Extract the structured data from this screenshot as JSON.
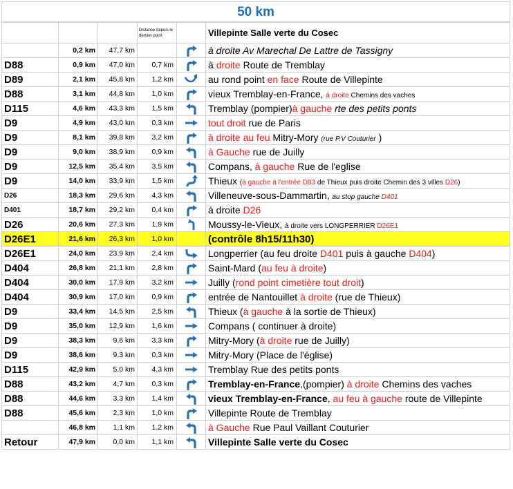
{
  "title": "50 km",
  "header": {
    "segment_label": "Distance depuis le dernier point",
    "start_label": "Villepinte Salle verte du Cosec"
  },
  "rows": [
    {
      "road": "",
      "cum": "0,2 km",
      "rem": "47,7 km",
      "seg": "",
      "arrow": "turn-right",
      "parts": [
        {
          "t": "à droite Av Marechal De Lattre de Tassigny",
          "s": "it"
        }
      ]
    },
    {
      "road": "D88",
      "cum": "0,9 km",
      "rem": "47,0 km",
      "seg": "0,7 km",
      "arrow": "turn-right",
      "parts": [
        {
          "t": "à "
        },
        {
          "t": "droite",
          "s": "red"
        },
        {
          "t": " Route de Tremblay"
        }
      ]
    },
    {
      "road": "D89",
      "cum": "2,1 km",
      "rem": "45,8 km",
      "seg": "1,2 km",
      "arrow": "roundabout-straight",
      "parts": [
        {
          "t": "au rond point "
        },
        {
          "t": "en face",
          "s": "red"
        },
        {
          "t": " Route de Villepinte"
        }
      ]
    },
    {
      "road": "D88",
      "cum": "3,1 km",
      "rem": "44,8 km",
      "seg": "1,0 km",
      "arrow": "turn-right",
      "parts": [
        {
          "t": "vieux Tremblay-en-France, "
        },
        {
          "t": "à droite",
          "s": "red tiny"
        },
        {
          "t": " Chemins des vaches",
          "s": "tiny"
        }
      ]
    },
    {
      "road": "D115",
      "cum": "4,6 km",
      "rem": "43,3 km",
      "seg": "1,5 km",
      "arrow": "turn-left",
      "parts": [
        {
          "t": "Tremblay (pompier)"
        },
        {
          "t": "à gauche",
          "s": "red"
        },
        {
          "t": " rte des petits ponts",
          "s": "it"
        }
      ]
    },
    {
      "road": "D9",
      "cum": "4,9 km",
      "rem": "43,0 km",
      "seg": "0,3 km",
      "arrow": "straight",
      "parts": [
        {
          "t": "tout droit",
          "s": "red"
        },
        {
          "t": " rue de Paris"
        }
      ]
    },
    {
      "road": "D9",
      "cum": "8,1 km",
      "rem": "39,8 km",
      "seg": "3,2 km",
      "arrow": "turn-right",
      "parts": [
        {
          "t": "à droite au feu",
          "s": "red"
        },
        {
          "t": " Mitry-Mory "
        },
        {
          "t": "(rue P.V Couturier",
          "s": "it tiny"
        },
        {
          "t": " )"
        }
      ]
    },
    {
      "road": "D9",
      "cum": "9,0 km",
      "rem": "38,9 km",
      "seg": "0,9 km",
      "arrow": "turn-left",
      "parts": [
        {
          "t": "à Gauche",
          "s": "red"
        },
        {
          "t": "   rue de Juilly"
        }
      ]
    },
    {
      "road": "D9",
      "cum": "12,5 km",
      "rem": "35,4 km",
      "seg": "3,5 km",
      "arrow": "turn-left",
      "parts": [
        {
          "t": "Compans, "
        },
        {
          "t": "à gauche",
          "s": "red"
        },
        {
          "t": " Rue de l'eglise",
          "s": "sm"
        }
      ]
    },
    {
      "road": "D9",
      "cum": "14,0 km",
      "rem": "33,9 km",
      "seg": "1,5 km",
      "arrow": "left-then-right",
      "parts": [
        {
          "t": "Thieux "
        },
        {
          "t": "(",
          "s": "tiny"
        },
        {
          "t": "à gauche à l'entrée D83",
          "s": "red tiny"
        },
        {
          "t": "  de Thieux puis droite Chemin des 3 villes ",
          "s": "tiny"
        },
        {
          "t": "D26",
          "s": "red tiny"
        },
        {
          "t": ")",
          "s": "tiny"
        }
      ]
    },
    {
      "road": "D26",
      "small": true,
      "cum": "18,3 km",
      "rem": "29,6 km",
      "seg": "4,3 km",
      "arrow": "turn-left",
      "parts": [
        {
          "t": "Villeneuve-sous-Dammartin, "
        },
        {
          "t": "au stop gauche ",
          "s": "it tiny"
        },
        {
          "t": "D401",
          "s": "red it tiny"
        }
      ]
    },
    {
      "road": "D401",
      "small": true,
      "cum": "18,7 km",
      "rem": "29,2 km",
      "seg": "0,4 km",
      "arrow": "turn-right",
      "parts": [
        {
          "t": " à droite "
        },
        {
          "t": "D26",
          "s": "red"
        }
      ]
    },
    {
      "road": "D26",
      "cum": "20,6 km",
      "rem": "27,3 km",
      "seg": "1,9 km",
      "arrow": "slight-left",
      "parts": [
        {
          "t": "Moussy-le-Vieux, "
        },
        {
          "t": " à droite vers LONGPERRIER ",
          "s": "tiny"
        },
        {
          "t": "D26E1",
          "s": "red tiny"
        }
      ]
    },
    {
      "road": "D26E1",
      "control": true,
      "cum": "21,6 km",
      "rem": "26,3 km",
      "seg": "1,0 km",
      "arrow": "",
      "parts": [
        {
          "t": "(contrôle 8h15/11h30)"
        }
      ]
    },
    {
      "road": "D26E1",
      "cum": "24,0 km",
      "rem": "23,9 km",
      "seg": "2,4 km",
      "arrow": "right-then-left",
      "parts": [
        {
          "t": "Longperrier "
        },
        {
          "t": "(au feu droite  ",
          "s": "sm"
        },
        {
          "t": "D401",
          "s": "red sm"
        },
        {
          "t": "  puis à gauche ",
          "s": "sm"
        },
        {
          "t": "D404",
          "s": "red sm"
        },
        {
          "t": ")",
          "s": "sm"
        }
      ]
    },
    {
      "road": "D404",
      "cum": "26,8 km",
      "rem": "21,1 km",
      "seg": "2,8 km",
      "arrow": "turn-right",
      "parts": [
        {
          "t": "Saint-Mard ("
        },
        {
          "t": "au feu à droite",
          "s": "red"
        },
        {
          "t": ")"
        }
      ]
    },
    {
      "road": "D404",
      "cum": "30,0 km",
      "rem": "17,9 km",
      "seg": "3,2 km",
      "arrow": "straight",
      "parts": [
        {
          "t": "Juilly ("
        },
        {
          "t": "rond point cimetière tout droit",
          "s": "red"
        },
        {
          "t": ")"
        }
      ]
    },
    {
      "road": "D404",
      "cum": "30,9 km",
      "rem": "17,0 km",
      "seg": "0,9 km",
      "arrow": "turn-right",
      "parts": [
        {
          "t": "entrée de Nantouillet "
        },
        {
          "t": "à droite",
          "s": "red"
        },
        {
          "t": " (rue de Thieux)"
        }
      ]
    },
    {
      "road": "D9",
      "cum": "33,4 km",
      "rem": "14,5 km",
      "seg": "2,5 km",
      "arrow": "turn-left",
      "parts": [
        {
          "t": "Thieux ("
        },
        {
          "t": "à gauche",
          "s": "red"
        },
        {
          "t": " à la sortie de Thieux)"
        }
      ]
    },
    {
      "road": "D9",
      "cum": "35,0 km",
      "rem": "12,9 km",
      "seg": "1,6 km",
      "arrow": "straight",
      "parts": [
        {
          "t": "Compans ( continuer à droite)"
        }
      ]
    },
    {
      "road": "D9",
      "cum": "38,3 km",
      "rem": "9,6 km",
      "seg": "3,3 km",
      "arrow": "turn-right",
      "parts": [
        {
          "t": "Mitry-Mory ("
        },
        {
          "t": "à droite",
          "s": "red"
        },
        {
          "t": " rue de Juilly)"
        }
      ]
    },
    {
      "road": "D9",
      "cum": "38,6 km",
      "rem": "9,3 km",
      "seg": "0,3 km",
      "arrow": "straight",
      "parts": [
        {
          "t": "Mitry-Mory (Place de l'église)"
        }
      ]
    },
    {
      "road": "D115",
      "cum": "42,9 km",
      "rem": "5,0 km",
      "seg": "4,3 km",
      "arrow": "straight",
      "parts": [
        {
          "t": "Tremblay  Rue des petits ponts"
        }
      ]
    },
    {
      "road": "D88",
      "cum": "43,2 km",
      "rem": "4,7 km",
      "seg": "0,3 km",
      "arrow": "turn-right",
      "parts": [
        {
          "t": "Tremblay-en-France",
          "s": "b"
        },
        {
          "t": ",(pompier) ",
          "s": "sm"
        },
        {
          "t": "à droite",
          "s": "red sm"
        },
        {
          "t": " Chemins des vaches",
          "s": "sm"
        }
      ]
    },
    {
      "road": "D88",
      "cum": "44,6 km",
      "rem": "3,3 km",
      "seg": "1,4 km",
      "arrow": "turn-left",
      "parts": [
        {
          "t": "vieux Tremblay-en-France",
          "s": "b"
        },
        {
          "t": ", "
        },
        {
          "t": "au feu à gauche",
          "s": "red sm"
        },
        {
          "t": " route de Villepinte",
          "s": "sm"
        }
      ]
    },
    {
      "road": "D88",
      "cum": "45,6 km",
      "rem": "2,3 km",
      "seg": "1,0 km",
      "arrow": "turn-right",
      "parts": [
        {
          "t": "Villepinte "
        },
        {
          "t": "Route de Tremblay",
          "s": "sm"
        }
      ]
    },
    {
      "road": "",
      "cum": "46,8 km",
      "rem": "1,1 km",
      "seg": "1,2 km",
      "arrow": "turn-left",
      "parts": [
        {
          "t": "à Gauche",
          "s": "red"
        },
        {
          "t": " Rue Paul Vaillant Couturier"
        }
      ]
    },
    {
      "road": "Retour",
      "cum": "47,9 km",
      "rem": "0,0 km",
      "seg": "1,1 km",
      "arrow": "turn-left",
      "parts": [
        {
          "t": "Villepinte Salle verte du Cosec",
          "s": "b sm"
        }
      ]
    }
  ],
  "colors": {
    "title": "#1f6fb4",
    "arrow": "#2f6fa3",
    "instruction_red": "#e0201b",
    "control_highlight": "#ffff22",
    "grid": "#cfcfcf"
  }
}
